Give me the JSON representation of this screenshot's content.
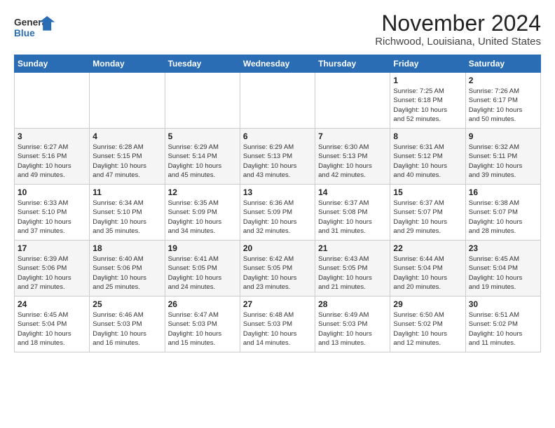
{
  "header": {
    "logo_line1": "General",
    "logo_line2": "Blue",
    "title": "November 2024",
    "subtitle": "Richwood, Louisiana, United States"
  },
  "weekdays": [
    "Sunday",
    "Monday",
    "Tuesday",
    "Wednesday",
    "Thursday",
    "Friday",
    "Saturday"
  ],
  "weeks": [
    [
      {
        "day": "",
        "info": ""
      },
      {
        "day": "",
        "info": ""
      },
      {
        "day": "",
        "info": ""
      },
      {
        "day": "",
        "info": ""
      },
      {
        "day": "",
        "info": ""
      },
      {
        "day": "1",
        "info": "Sunrise: 7:25 AM\nSunset: 6:18 PM\nDaylight: 10 hours\nand 52 minutes."
      },
      {
        "day": "2",
        "info": "Sunrise: 7:26 AM\nSunset: 6:17 PM\nDaylight: 10 hours\nand 50 minutes."
      }
    ],
    [
      {
        "day": "3",
        "info": "Sunrise: 6:27 AM\nSunset: 5:16 PM\nDaylight: 10 hours\nand 49 minutes."
      },
      {
        "day": "4",
        "info": "Sunrise: 6:28 AM\nSunset: 5:15 PM\nDaylight: 10 hours\nand 47 minutes."
      },
      {
        "day": "5",
        "info": "Sunrise: 6:29 AM\nSunset: 5:14 PM\nDaylight: 10 hours\nand 45 minutes."
      },
      {
        "day": "6",
        "info": "Sunrise: 6:29 AM\nSunset: 5:13 PM\nDaylight: 10 hours\nand 43 minutes."
      },
      {
        "day": "7",
        "info": "Sunrise: 6:30 AM\nSunset: 5:13 PM\nDaylight: 10 hours\nand 42 minutes."
      },
      {
        "day": "8",
        "info": "Sunrise: 6:31 AM\nSunset: 5:12 PM\nDaylight: 10 hours\nand 40 minutes."
      },
      {
        "day": "9",
        "info": "Sunrise: 6:32 AM\nSunset: 5:11 PM\nDaylight: 10 hours\nand 39 minutes."
      }
    ],
    [
      {
        "day": "10",
        "info": "Sunrise: 6:33 AM\nSunset: 5:10 PM\nDaylight: 10 hours\nand 37 minutes."
      },
      {
        "day": "11",
        "info": "Sunrise: 6:34 AM\nSunset: 5:10 PM\nDaylight: 10 hours\nand 35 minutes."
      },
      {
        "day": "12",
        "info": "Sunrise: 6:35 AM\nSunset: 5:09 PM\nDaylight: 10 hours\nand 34 minutes."
      },
      {
        "day": "13",
        "info": "Sunrise: 6:36 AM\nSunset: 5:09 PM\nDaylight: 10 hours\nand 32 minutes."
      },
      {
        "day": "14",
        "info": "Sunrise: 6:37 AM\nSunset: 5:08 PM\nDaylight: 10 hours\nand 31 minutes."
      },
      {
        "day": "15",
        "info": "Sunrise: 6:37 AM\nSunset: 5:07 PM\nDaylight: 10 hours\nand 29 minutes."
      },
      {
        "day": "16",
        "info": "Sunrise: 6:38 AM\nSunset: 5:07 PM\nDaylight: 10 hours\nand 28 minutes."
      }
    ],
    [
      {
        "day": "17",
        "info": "Sunrise: 6:39 AM\nSunset: 5:06 PM\nDaylight: 10 hours\nand 27 minutes."
      },
      {
        "day": "18",
        "info": "Sunrise: 6:40 AM\nSunset: 5:06 PM\nDaylight: 10 hours\nand 25 minutes."
      },
      {
        "day": "19",
        "info": "Sunrise: 6:41 AM\nSunset: 5:05 PM\nDaylight: 10 hours\nand 24 minutes."
      },
      {
        "day": "20",
        "info": "Sunrise: 6:42 AM\nSunset: 5:05 PM\nDaylight: 10 hours\nand 23 minutes."
      },
      {
        "day": "21",
        "info": "Sunrise: 6:43 AM\nSunset: 5:05 PM\nDaylight: 10 hours\nand 21 minutes."
      },
      {
        "day": "22",
        "info": "Sunrise: 6:44 AM\nSunset: 5:04 PM\nDaylight: 10 hours\nand 20 minutes."
      },
      {
        "day": "23",
        "info": "Sunrise: 6:45 AM\nSunset: 5:04 PM\nDaylight: 10 hours\nand 19 minutes."
      }
    ],
    [
      {
        "day": "24",
        "info": "Sunrise: 6:45 AM\nSunset: 5:04 PM\nDaylight: 10 hours\nand 18 minutes."
      },
      {
        "day": "25",
        "info": "Sunrise: 6:46 AM\nSunset: 5:03 PM\nDaylight: 10 hours\nand 16 minutes."
      },
      {
        "day": "26",
        "info": "Sunrise: 6:47 AM\nSunset: 5:03 PM\nDaylight: 10 hours\nand 15 minutes."
      },
      {
        "day": "27",
        "info": "Sunrise: 6:48 AM\nSunset: 5:03 PM\nDaylight: 10 hours\nand 14 minutes."
      },
      {
        "day": "28",
        "info": "Sunrise: 6:49 AM\nSunset: 5:03 PM\nDaylight: 10 hours\nand 13 minutes."
      },
      {
        "day": "29",
        "info": "Sunrise: 6:50 AM\nSunset: 5:02 PM\nDaylight: 10 hours\nand 12 minutes."
      },
      {
        "day": "30",
        "info": "Sunrise: 6:51 AM\nSunset: 5:02 PM\nDaylight: 10 hours\nand 11 minutes."
      }
    ]
  ]
}
